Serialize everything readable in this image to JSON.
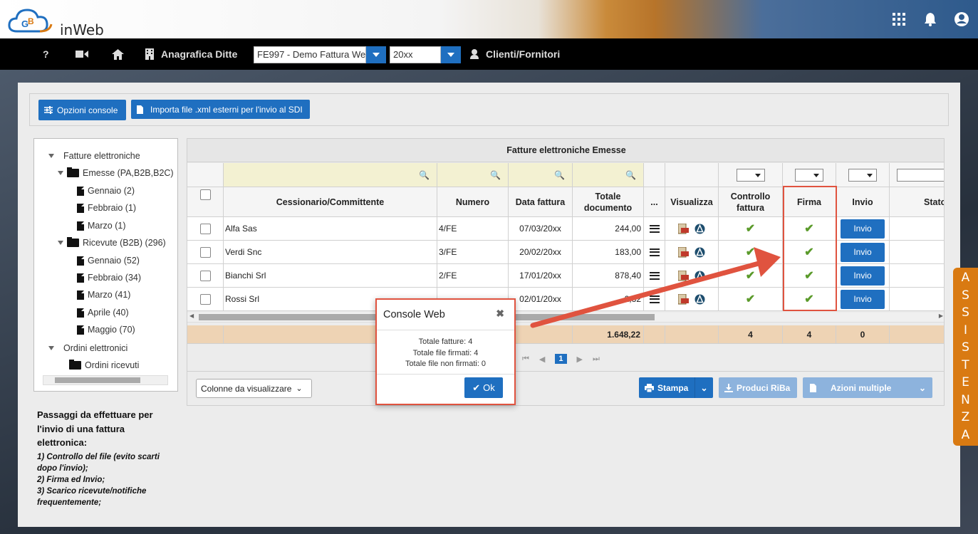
{
  "app": {
    "logo_text": "inWeb",
    "logo_badge": "GB"
  },
  "top_icons": [
    "apps-grid-icon",
    "bell-icon",
    "account-icon"
  ],
  "nav": {
    "help": "?",
    "anagrafica": "Anagrafica Ditte",
    "company_select": "FE997 - Demo Fattura We",
    "year_select": "20xx",
    "clienti": "Clienti/Fornitori"
  },
  "toolbar": {
    "opzioni": "Opzioni console",
    "importa": "Importa file .xml esterni per l'invio al SDI"
  },
  "tree": {
    "root": "Fatture elettroniche",
    "emesse": "Emesse (PA,B2B,B2C)",
    "emesse_children": [
      "Gennaio (2)",
      "Febbraio (1)",
      "Marzo (1)"
    ],
    "ricevute": "Ricevute (B2B) (296)",
    "ricevute_children": [
      "Gennaio (52)",
      "Febbraio (34)",
      "Marzo (41)",
      "Aprile (40)",
      "Maggio (70)"
    ],
    "ordini": "Ordini elettronici",
    "ordini_ricevuti": "Ordini ricevuti"
  },
  "notes": {
    "heading": "Passaggi da effettuare per l'invio di una fattura elettronica:",
    "steps": [
      "1) Controllo del file (evito scarti dopo l'invio);",
      "2) Firma ed Invio;",
      "3) Scarico ricevute/notifiche frequentemente;"
    ]
  },
  "grid": {
    "title": "Fatture elettroniche Emesse",
    "headers": {
      "cessionario": "Cessionario/Committente",
      "numero": "Numero",
      "data": "Data fattura",
      "totale": "Totale documento",
      "more": "...",
      "visualizza": "Visualizza",
      "controllo": "Controllo fattura",
      "firma": "Firma",
      "invio": "Invio",
      "stato": "Stato"
    },
    "rows": [
      {
        "cessionario": "Alfa Sas",
        "numero": "4/FE",
        "data": "07/03/20xx",
        "totale": "244,00",
        "invio": "Invio"
      },
      {
        "cessionario": "Verdi Snc",
        "numero": "3/FE",
        "data": "20/02/20xx",
        "totale": "183,00",
        "invio": "Invio"
      },
      {
        "cessionario": "Bianchi Srl",
        "numero": "2/FE",
        "data": "17/01/20xx",
        "totale": "878,40",
        "invio": "Invio"
      },
      {
        "cessionario": "Rossi Srl",
        "numero": "",
        "data": "02/01/20xx",
        "totale": "..2,82",
        "invio": "Invio"
      }
    ],
    "totals": {
      "totale": "1.648,22",
      "controllo": "4",
      "firma": "4",
      "invio": "0"
    },
    "pager": {
      "current": "1"
    }
  },
  "bottom": {
    "colonne": "Colonne da visualizzare",
    "stampa": "Stampa",
    "riba": "Produci RiBa",
    "azioni": "Azioni multiple"
  },
  "dialog": {
    "title": "Console Web",
    "close": "✖",
    "line1": "Totale fatture: 4",
    "line2": "Totale file firmati: 4",
    "line3": "Totale file non firmati: 0",
    "ok": "Ok"
  },
  "assistenza": [
    "A",
    "S",
    "S",
    "I",
    "S",
    "T",
    "E",
    "N",
    "Z",
    "A"
  ],
  "colors": {
    "primary": "#1f6fc0",
    "accent": "#d97a12",
    "highlight": "#e0533f",
    "check": "#5a9a2a"
  }
}
